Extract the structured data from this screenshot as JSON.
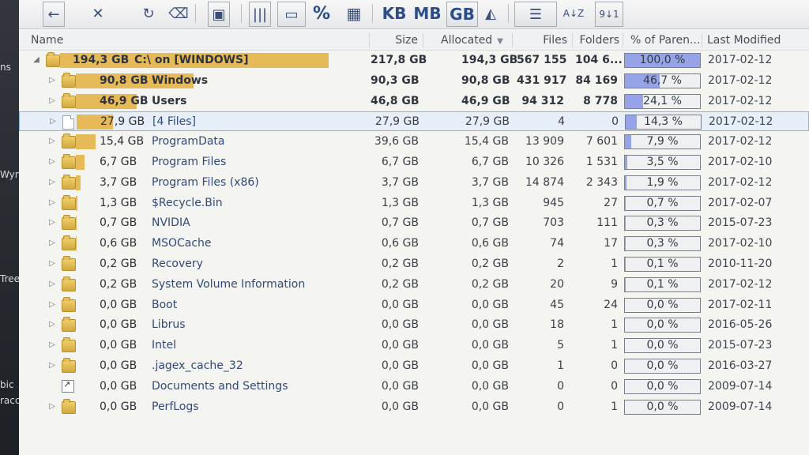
{
  "left_strip": {
    "labels": [
      "ns",
      "Wyn",
      "Tree",
      "bic",
      "racc"
    ]
  },
  "toolbar": {
    "items": [
      {
        "name": "back-button",
        "label": "←"
      },
      {
        "name": "delete-button",
        "label": "✕"
      },
      {
        "name": "refresh-button",
        "label": "↻"
      },
      {
        "name": "cleanup-button",
        "label": "⌫"
      },
      {
        "name": "save-button",
        "label": "▣"
      },
      {
        "name": "columns-button",
        "label": "|||"
      },
      {
        "name": "drive-button",
        "label": "▭"
      },
      {
        "name": "percent-button",
        "label": "%"
      },
      {
        "name": "grid-button",
        "label": "▦"
      },
      {
        "name": "kb-button",
        "label": "KB"
      },
      {
        "name": "mb-button",
        "label": "MB"
      },
      {
        "name": "gb-button",
        "label": "GB"
      },
      {
        "name": "ruler-button",
        "label": "◭"
      },
      {
        "name": "list-view-button",
        "label": "☰"
      },
      {
        "name": "sort-az-button",
        "label": "A↓Z"
      },
      {
        "name": "sort-num-button",
        "label": "9↓1"
      }
    ]
  },
  "columns": {
    "name": "Name",
    "size": "Size",
    "allocated": "Allocated",
    "files": "Files",
    "folders": "Folders",
    "percent": "% of Paren...",
    "modified": "Last Modified"
  },
  "rows": [
    {
      "indent": 0,
      "expander": "◢",
      "icon": "folder-icon",
      "size_label": "194,3 GB",
      "name": "C:\\  on  [WINDOWS]",
      "size": "217,8 GB",
      "allocated": "194,3 GB",
      "files": "567 155",
      "folders": "104 6...",
      "percent": "100,0 %",
      "percent_fraction": 1.0,
      "modified": "2017-02-12",
      "bar_fraction": 1.0,
      "style": "dark"
    },
    {
      "indent": 1,
      "expander": "▷",
      "icon": "folder-icon",
      "size_label": "90,8 GB",
      "name": "Windows",
      "size": "90,3 GB",
      "allocated": "90,8 GB",
      "files": "431 917",
      "folders": "84 169",
      "percent": "46,7 %",
      "percent_fraction": 0.467,
      "modified": "2017-02-12",
      "bar_fraction": 0.467,
      "style": "dark"
    },
    {
      "indent": 1,
      "expander": "▷",
      "icon": "folder-icon",
      "size_label": "46,9 GB",
      "name": "Users",
      "size": "46,8 GB",
      "allocated": "46,9 GB",
      "files": "94 312",
      "folders": "8 778",
      "percent": "24,1 %",
      "percent_fraction": 0.241,
      "modified": "2017-02-12",
      "bar_fraction": 0.241,
      "style": "dark"
    },
    {
      "indent": 1,
      "expander": "▷",
      "icon": "file-icon",
      "size_label": "27,9 GB",
      "name": "[4 Files]",
      "size": "27,9 GB",
      "allocated": "27,9 GB",
      "files": "4",
      "folders": "0",
      "percent": "14,3 %",
      "percent_fraction": 0.143,
      "modified": "2017-02-12",
      "bar_fraction": 0.143,
      "style": "normal",
      "selected": true
    },
    {
      "indent": 1,
      "expander": "▷",
      "icon": "folder-icon",
      "size_label": "15,4 GB",
      "name": "ProgramData",
      "size": "39,6 GB",
      "allocated": "15,4 GB",
      "files": "13 909",
      "folders": "7 601",
      "percent": "7,9 %",
      "percent_fraction": 0.079,
      "modified": "2017-02-12",
      "bar_fraction": 0.079,
      "style": "blue"
    },
    {
      "indent": 1,
      "expander": "▷",
      "icon": "folder-icon",
      "size_label": "6,7 GB",
      "name": "Program Files",
      "size": "6,7 GB",
      "allocated": "6,7 GB",
      "files": "10 326",
      "folders": "1 531",
      "percent": "3,5 %",
      "percent_fraction": 0.035,
      "modified": "2017-02-10",
      "bar_fraction": 0.035,
      "style": "blue"
    },
    {
      "indent": 1,
      "expander": "▷",
      "icon": "folder-icon",
      "size_label": "3,7 GB",
      "name": "Program Files (x86)",
      "size": "3,7 GB",
      "allocated": "3,7 GB",
      "files": "14 874",
      "folders": "2 343",
      "percent": "1,9 %",
      "percent_fraction": 0.019,
      "modified": "2017-02-12",
      "bar_fraction": 0.019,
      "style": "blue"
    },
    {
      "indent": 1,
      "expander": "▷",
      "icon": "folder-icon",
      "size_label": "1,3 GB",
      "name": "$Recycle.Bin",
      "size": "1,3 GB",
      "allocated": "1,3 GB",
      "files": "945",
      "folders": "27",
      "percent": "0,7 %",
      "percent_fraction": 0.007,
      "modified": "2017-02-07",
      "bar_fraction": 0.007,
      "style": "blue"
    },
    {
      "indent": 1,
      "expander": "▷",
      "icon": "folder-icon",
      "size_label": "0,7 GB",
      "name": "NVIDIA",
      "size": "0,7 GB",
      "allocated": "0,7 GB",
      "files": "703",
      "folders": "111",
      "percent": "0,3 %",
      "percent_fraction": 0.003,
      "modified": "2015-07-23",
      "bar_fraction": 0.003,
      "style": "blue"
    },
    {
      "indent": 1,
      "expander": "▷",
      "icon": "folder-icon",
      "size_label": "0,6 GB",
      "name": "MSOCache",
      "size": "0,6 GB",
      "allocated": "0,6 GB",
      "files": "74",
      "folders": "17",
      "percent": "0,3 %",
      "percent_fraction": 0.003,
      "modified": "2017-02-10",
      "bar_fraction": 0.003,
      "style": "blue"
    },
    {
      "indent": 1,
      "expander": "▷",
      "icon": "folder-icon",
      "size_label": "0,2 GB",
      "name": "Recovery",
      "size": "0,2 GB",
      "allocated": "0,2 GB",
      "files": "2",
      "folders": "1",
      "percent": "0,1 %",
      "percent_fraction": 0.001,
      "modified": "2010-11-20",
      "bar_fraction": 0.001,
      "style": "blue"
    },
    {
      "indent": 1,
      "expander": "▷",
      "icon": "folder-icon",
      "size_label": "0,2 GB",
      "name": "System Volume Information",
      "size": "0,2 GB",
      "allocated": "0,2 GB",
      "files": "20",
      "folders": "9",
      "percent": "0,1 %",
      "percent_fraction": 0.001,
      "modified": "2017-02-12",
      "bar_fraction": 0.001,
      "style": "blue"
    },
    {
      "indent": 1,
      "expander": "▷",
      "icon": "folder-icon",
      "size_label": "0,0 GB",
      "name": "Boot",
      "size": "0,0 GB",
      "allocated": "0,0 GB",
      "files": "45",
      "folders": "24",
      "percent": "0,0 %",
      "percent_fraction": 0.0,
      "modified": "2017-02-11",
      "bar_fraction": 0.0,
      "style": "blue"
    },
    {
      "indent": 1,
      "expander": "▷",
      "icon": "folder-icon",
      "size_label": "0,0 GB",
      "name": "Librus",
      "size": "0,0 GB",
      "allocated": "0,0 GB",
      "files": "18",
      "folders": "1",
      "percent": "0,0 %",
      "percent_fraction": 0.0,
      "modified": "2016-05-26",
      "bar_fraction": 0.0,
      "style": "blue"
    },
    {
      "indent": 1,
      "expander": "▷",
      "icon": "folder-icon",
      "size_label": "0,0 GB",
      "name": "Intel",
      "size": "0,0 GB",
      "allocated": "0,0 GB",
      "files": "5",
      "folders": "1",
      "percent": "0,0 %",
      "percent_fraction": 0.0,
      "modified": "2015-07-23",
      "bar_fraction": 0.0,
      "style": "blue"
    },
    {
      "indent": 1,
      "expander": "▷",
      "icon": "folder-icon",
      "size_label": "0,0 GB",
      "name": ".jagex_cache_32",
      "size": "0,0 GB",
      "allocated": "0,0 GB",
      "files": "1",
      "folders": "0",
      "percent": "0,0 %",
      "percent_fraction": 0.0,
      "modified": "2016-03-27",
      "bar_fraction": 0.0,
      "style": "blue"
    },
    {
      "indent": 1,
      "expander": "",
      "icon": "shortcut-icon",
      "size_label": "0,0 GB",
      "name": "Documents and Settings",
      "size": "0,0 GB",
      "allocated": "0,0 GB",
      "files": "0",
      "folders": "0",
      "percent": "0,0 %",
      "percent_fraction": 0.0,
      "modified": "2009-07-14",
      "bar_fraction": 0.0,
      "style": "blue"
    },
    {
      "indent": 1,
      "expander": "▷",
      "icon": "folder-icon",
      "size_label": "0,0 GB",
      "name": "PerfLogs",
      "size": "0,0 GB",
      "allocated": "0,0 GB",
      "files": "0",
      "folders": "1",
      "percent": "0,0 %",
      "percent_fraction": 0.0,
      "modified": "2009-07-14",
      "bar_fraction": 0.0,
      "style": "blue"
    }
  ]
}
